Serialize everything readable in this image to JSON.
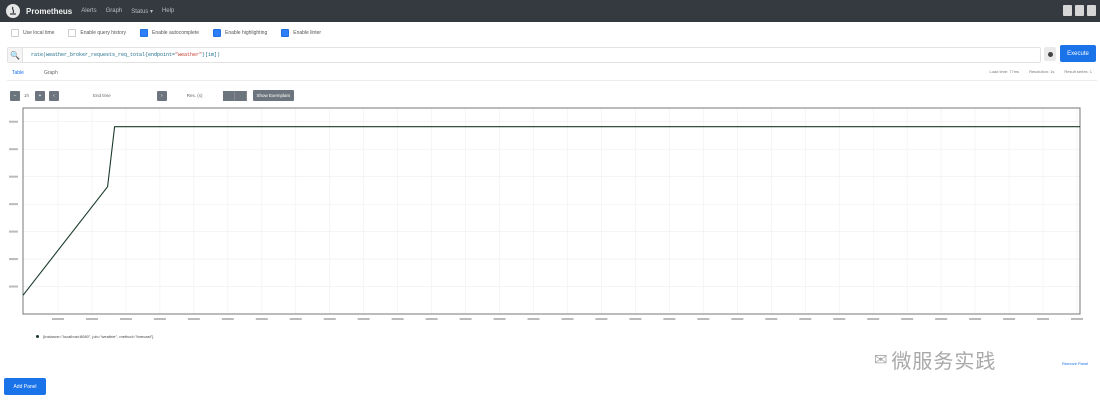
{
  "app": {
    "brand": "Prometheus",
    "nav": [
      "Alerts",
      "Graph",
      "Status ▾",
      "Help"
    ]
  },
  "options": [
    {
      "label": "Use local time",
      "checked": false
    },
    {
      "label": "Enable query history",
      "checked": false
    },
    {
      "label": "Enable autocomplete",
      "checked": true
    },
    {
      "label": "Enable highlighting",
      "checked": true
    },
    {
      "label": "Enable linter",
      "checked": true
    }
  ],
  "query": {
    "expr_prefix": "rate(weather_broker_requests_req_total{endpoint=",
    "expr_string": "\"weather\"",
    "expr_suffix": "}[1m])",
    "execute_label": "Execute"
  },
  "tabs": [
    "Table",
    "Graph"
  ],
  "panel_info": {
    "load_time": "Load time: 77ms",
    "resolution": "Resolution: 1s",
    "result_series": "Result series: 1"
  },
  "controls": {
    "range": "1h",
    "end_time": "End time",
    "res": "Res. (s)",
    "hide_exemplars": "Show Exemplars"
  },
  "chart_data": {
    "type": "line",
    "series": [
      {
        "name": "{instance=\"localhost:8080\", job=\"weather\", method=\"forecast\"}",
        "points": [
          [
            0,
            0.1
          ],
          [
            24,
            0.68
          ],
          [
            26,
            1.0
          ],
          [
            300,
            1.0
          ]
        ]
      }
    ],
    "xlim": [
      0,
      300
    ],
    "ylim": [
      0,
      1.1
    ],
    "grid": true,
    "legend": "bottom-left"
  },
  "colors": {
    "line": "#1a3b2a",
    "accent": "#1a73e8",
    "nav_bg": "#343a40"
  },
  "remove_panel": "Remove Panel",
  "add_panel": "Add Panel",
  "watermark": {
    "text": "微服务实践",
    "icon": "wechat-icon"
  }
}
